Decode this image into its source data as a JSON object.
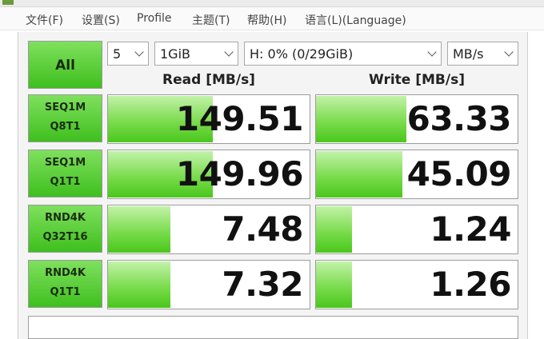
{
  "menu": {
    "items": [
      "文件(F)",
      "设置(S)",
      "Profile",
      "主题(T)",
      "帮助(H)",
      "语言(L)(Language)"
    ]
  },
  "controls": {
    "all_label": "All",
    "count": "5",
    "size": "1GiB",
    "drive": "H: 0% (0/29GiB)",
    "unit": "MB/s"
  },
  "headers": {
    "read": "Read [MB/s]",
    "write": "Write [MB/s]"
  },
  "tests": [
    {
      "line1": "SEQ1M",
      "line2": "Q8T1",
      "read": "149.51",
      "write": "63.33",
      "read_fill": 0.52,
      "write_fill": 0.45
    },
    {
      "line1": "SEQ1M",
      "line2": "Q1T1",
      "read": "149.96",
      "write": "45.09",
      "read_fill": 0.52,
      "write_fill": 0.43
    },
    {
      "line1": "RND4K",
      "line2": "Q32T16",
      "read": "7.48",
      "write": "1.24",
      "read_fill": 0.31,
      "write_fill": 0.18
    },
    {
      "line1": "RND4K",
      "line2": "Q1T1",
      "read": "7.32",
      "write": "1.26",
      "read_fill": 0.31,
      "write_fill": 0.18
    }
  ],
  "status": {
    "text": ""
  }
}
